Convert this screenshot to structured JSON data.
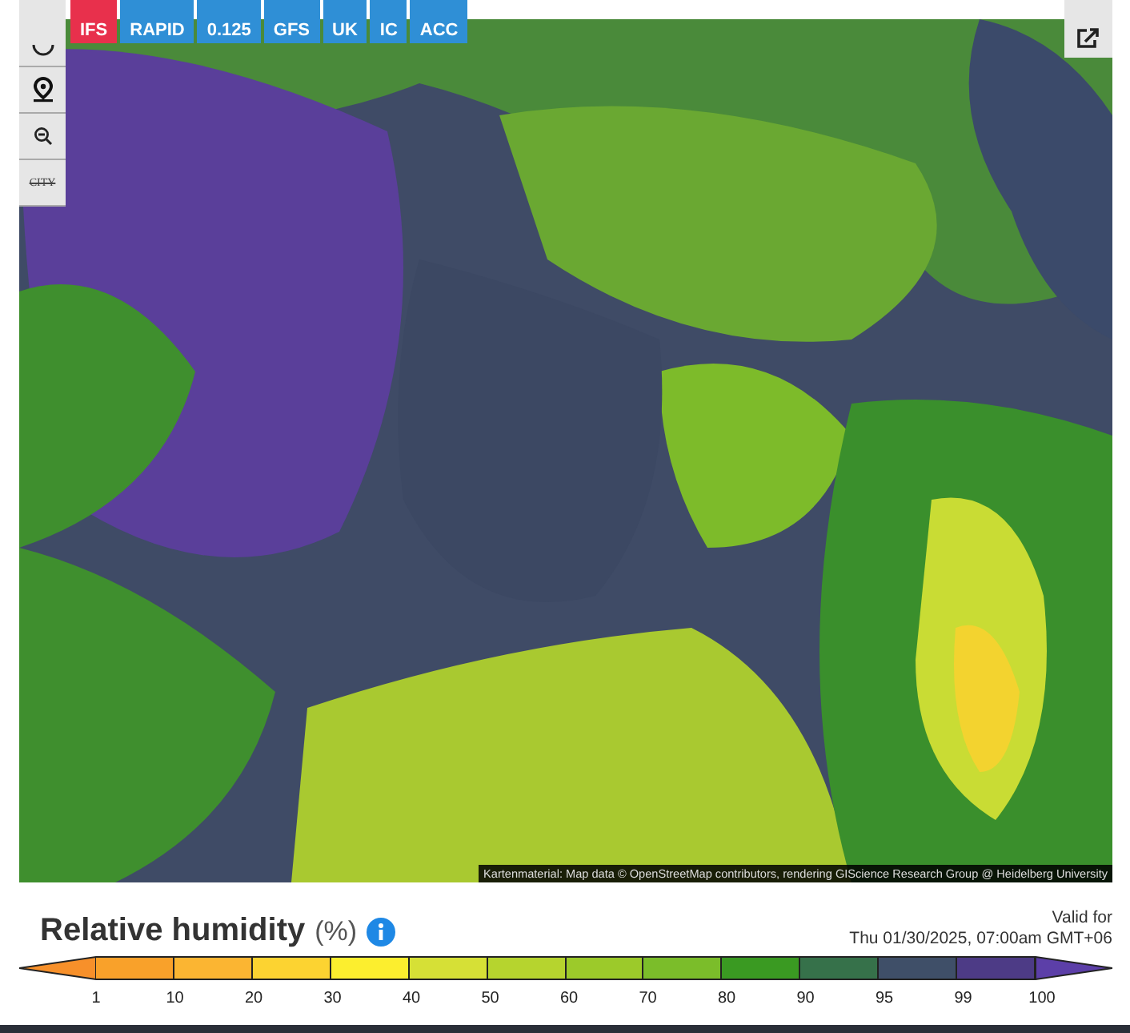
{
  "model_buttons": [
    {
      "label": "IFS",
      "selected": true
    },
    {
      "label": "RAPID",
      "selected": false
    },
    {
      "label": "0.125",
      "selected": false
    },
    {
      "label": "GFS",
      "selected": false
    },
    {
      "label": "UK",
      "selected": false
    },
    {
      "label": "IC",
      "selected": false
    },
    {
      "label": "ACC",
      "selected": false
    }
  ],
  "map_toolbar": {
    "city_label": "CITY"
  },
  "attribution": "Kartenmaterial: Map data © OpenStreetMap contributors, rendering GIScience Research Group @ Heidelberg University",
  "legend": {
    "title": "Relative humidity",
    "unit": "(%)",
    "valid_label": "Valid for",
    "valid_time": "Thu 01/30/2025, 07:00am GMT+06",
    "segments": [
      {
        "kind": "arrow-left",
        "color": "#f7902a"
      },
      {
        "kind": "band",
        "color": "#f9a12a"
      },
      {
        "kind": "band",
        "color": "#fbb532"
      },
      {
        "kind": "band",
        "color": "#fcd331"
      },
      {
        "kind": "band",
        "color": "#fcee2e"
      },
      {
        "kind": "band",
        "color": "#d6e036"
      },
      {
        "kind": "band",
        "color": "#b6d42e"
      },
      {
        "kind": "band",
        "color": "#9cca2a"
      },
      {
        "kind": "band",
        "color": "#7bbd2a"
      },
      {
        "kind": "band",
        "color": "#3a9a22"
      },
      {
        "kind": "band",
        "color": "#36714a"
      },
      {
        "kind": "band",
        "color": "#3f4f68"
      },
      {
        "kind": "band",
        "color": "#4d3b86"
      },
      {
        "kind": "arrow-right",
        "color": "#5c3fa8"
      }
    ],
    "labels": [
      "1",
      "10",
      "20",
      "30",
      "40",
      "50",
      "60",
      "70",
      "80",
      "90",
      "95",
      "99",
      "100"
    ]
  }
}
